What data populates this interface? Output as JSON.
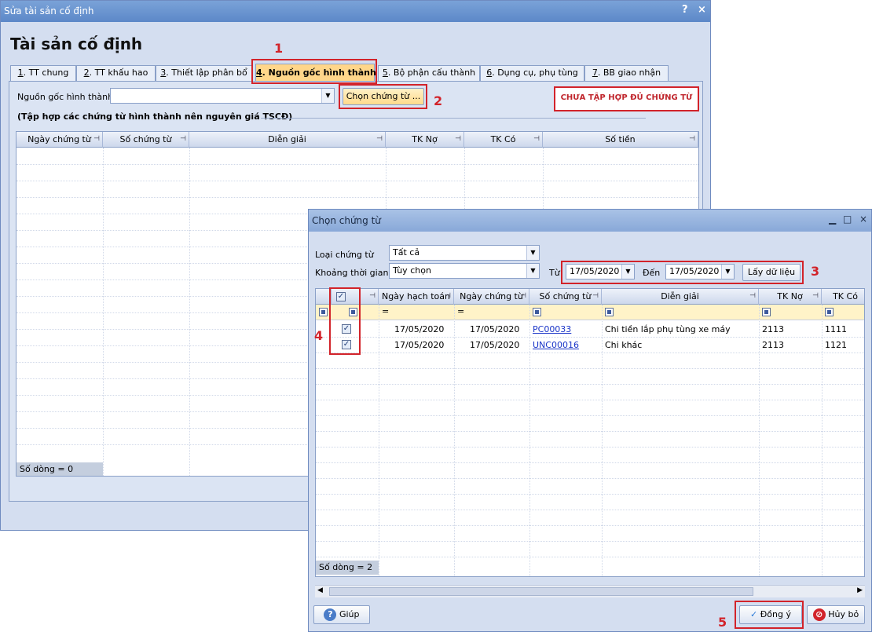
{
  "main": {
    "window_title": "Sửa tài sản cố định",
    "help_glyph": "?",
    "close_glyph": "×",
    "page_title": "Tài sản cố định",
    "tabs": [
      {
        "num": "1",
        "label": ". TT chung"
      },
      {
        "num": "2",
        "label": ". TT khấu hao"
      },
      {
        "num": "3",
        "label": ". Thiết lập phân bổ"
      },
      {
        "num": "4",
        "label": ". Nguồn gốc hình thành"
      },
      {
        "num": "5",
        "label": ". Bộ phận cấu thành"
      },
      {
        "num": "6",
        "label": ". Dụng cụ, phụ tùng"
      },
      {
        "num": "7",
        "label": ". BB giao nhận"
      }
    ],
    "source_label": "Nguồn gốc hình thành",
    "source_value": "",
    "choose_button": "Chọn chứng từ ...",
    "warning": "CHƯA TẬP HỢP ĐỦ CHỨNG TỪ",
    "section_title": "(Tập hợp các chứng từ hình thành nên nguyên giá TSCĐ)",
    "grid_columns": [
      "Ngày chứng từ",
      "Số chứng từ",
      "Diễn giải",
      "TK Nợ",
      "TK Có",
      "Số tiền"
    ],
    "row_count": "Số dòng = 0"
  },
  "dialog": {
    "title": "Chọn chứng từ",
    "type_label": "Loại chứng từ",
    "type_value": "Tất cả",
    "period_label": "Khoảng thời gian",
    "period_value": "Tùy chọn",
    "from_label": "Từ",
    "from_value": "17/05/2020",
    "to_label": "Đến",
    "to_value": "17/05/2020",
    "fetch_button": "Lấy dữ liệu",
    "columns": [
      "Ngày hạch toán",
      "Ngày chứng từ",
      "Số chứng từ",
      "Diễn giải",
      "TK Nợ",
      "TK Có"
    ],
    "filter_eq": "=",
    "rows": [
      {
        "posting_date": "17/05/2020",
        "doc_date": "17/05/2020",
        "doc_no": "PC00033",
        "description": "Chi tiền lắp phụ tùng xe máy",
        "debit": "2113",
        "credit": "1111",
        "checked": true
      },
      {
        "posting_date": "17/05/2020",
        "doc_date": "17/05/2020",
        "doc_no": "UNC00016",
        "description": "Chi khác",
        "debit": "2113",
        "credit": "1121",
        "checked": true
      }
    ],
    "row_count": "Số dòng = 2",
    "help_button": "Giúp",
    "ok_button": "Đồng ý",
    "cancel_button": "Hủy bỏ"
  },
  "annotations": [
    "1",
    "2",
    "3",
    "4",
    "5"
  ],
  "colors": {
    "annotation_red": "#d2232a",
    "active_tab": "#ffd68a",
    "link": "#1a35c8"
  }
}
